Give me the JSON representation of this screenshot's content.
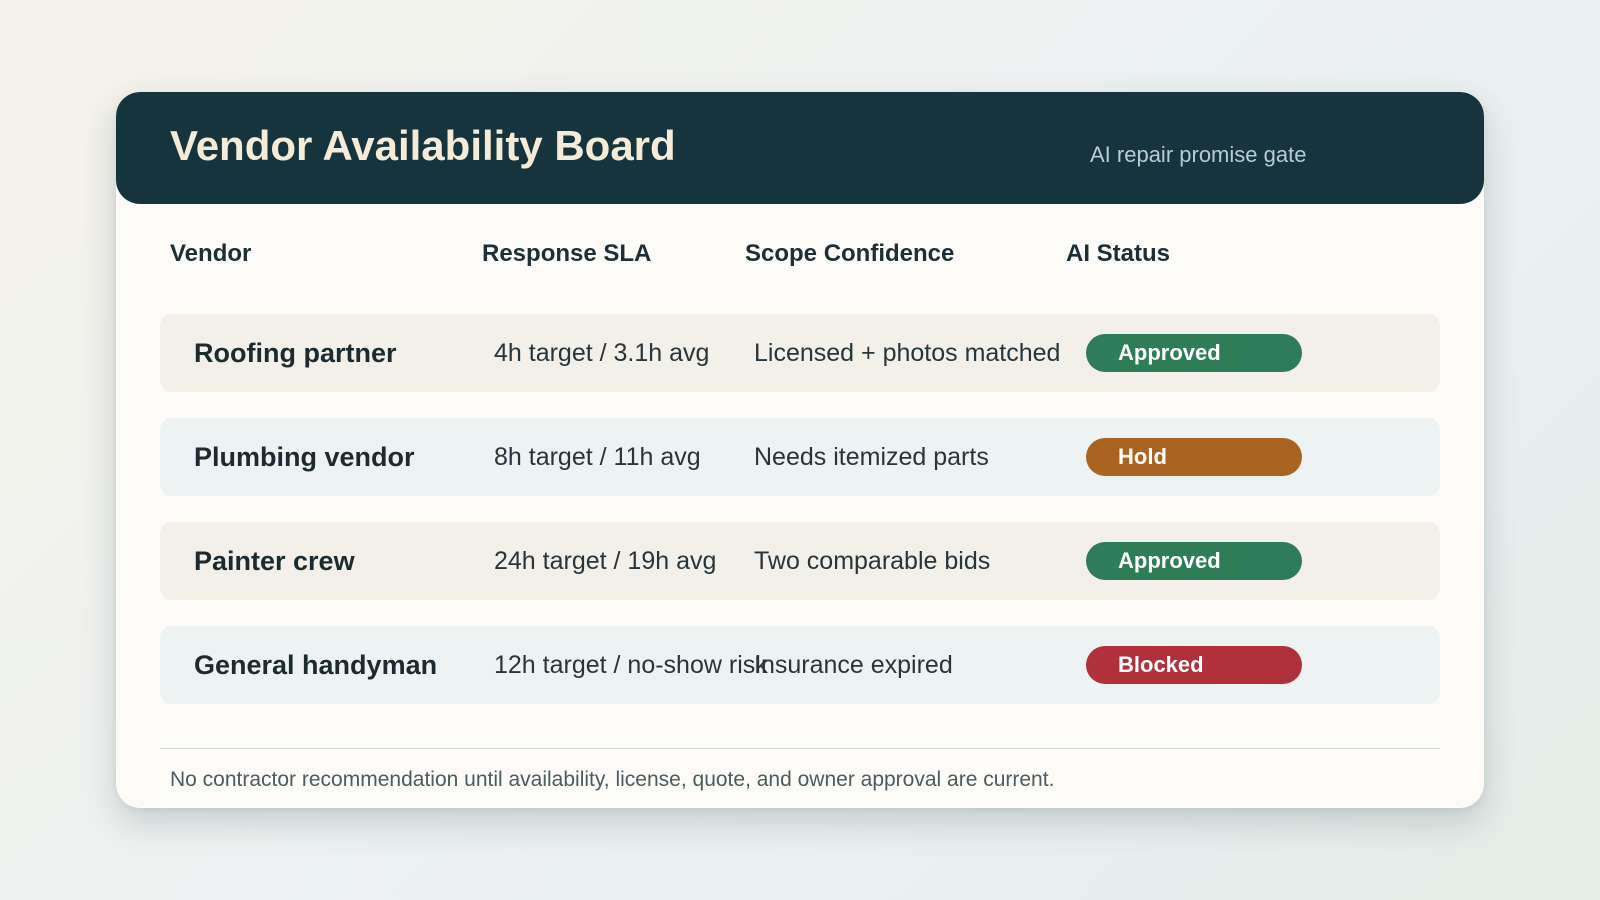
{
  "header": {
    "title": "Vendor Availability Board",
    "subtitle": "AI repair promise gate"
  },
  "columns": {
    "vendor": "Vendor",
    "sla": "Response SLA",
    "scope": "Scope Confidence",
    "status": "AI Status"
  },
  "status_colors": {
    "approved": "#2e7d57",
    "hold": "#a96422",
    "blocked": "#b0303c"
  },
  "rows": [
    {
      "vendor": "Roofing partner",
      "sla": "4h target / 3.1h avg",
      "scope": "Licensed + photos matched",
      "status": "Approved",
      "status_color": "#2e7d57"
    },
    {
      "vendor": "Plumbing vendor",
      "sla": "8h target / 11h avg",
      "scope": "Needs itemized parts",
      "status": "Hold",
      "status_color": "#a96422"
    },
    {
      "vendor": "Painter crew",
      "sla": "24h target / 19h avg",
      "scope": "Two comparable bids",
      "status": "Approved",
      "status_color": "#2e7d57"
    },
    {
      "vendor": "General handyman",
      "sla": "12h target / no-show risk",
      "scope": "Insurance expired",
      "status": "Blocked",
      "status_color": "#b0303c"
    }
  ],
  "footnote": "No contractor recommendation until availability, license, quote, and owner approval are current."
}
